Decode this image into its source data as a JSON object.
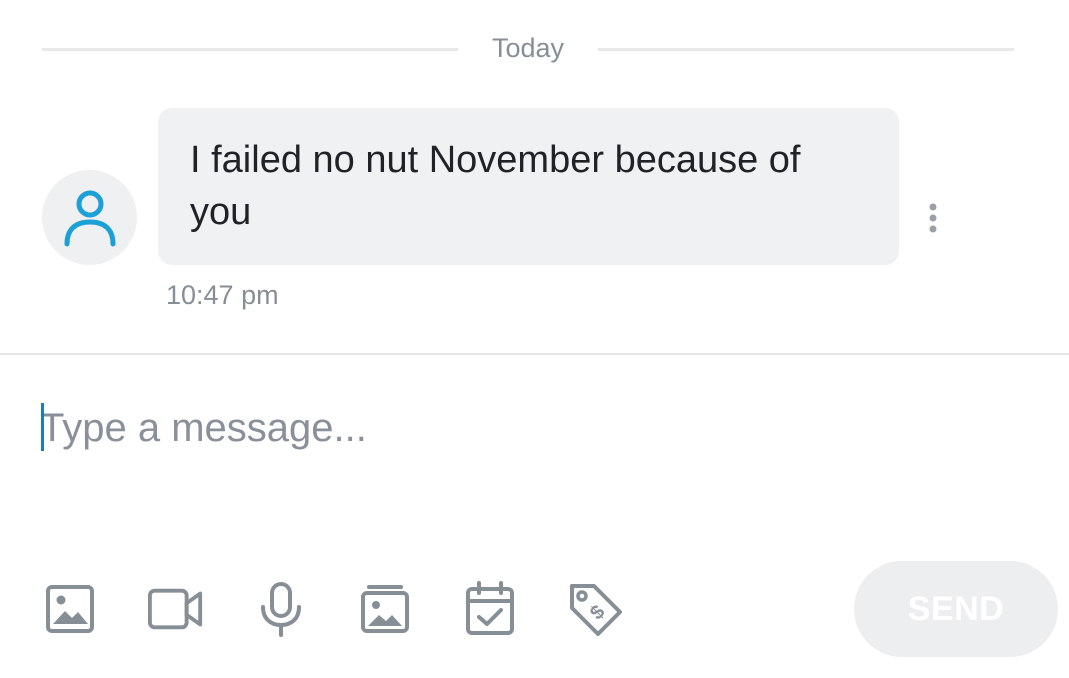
{
  "conversation": {
    "date_divider": "Today",
    "messages": [
      {
        "sender_icon": "user-icon",
        "text": "I failed no nut November because of you",
        "time": "10:47 pm"
      }
    ]
  },
  "composer": {
    "placeholder": "Type a message...",
    "value": "",
    "send_label": "SEND",
    "send_enabled": false
  },
  "toolbar": {
    "icons": [
      "image-icon",
      "video-icon",
      "microphone-icon",
      "gallery-icon",
      "calendar-check-icon",
      "price-tag-icon"
    ]
  },
  "colors": {
    "accent": "#1ca0d6",
    "icon_gray": "#868e96",
    "bubble_bg": "#f0f1f3",
    "send_disabled_bg": "#eceef0"
  }
}
